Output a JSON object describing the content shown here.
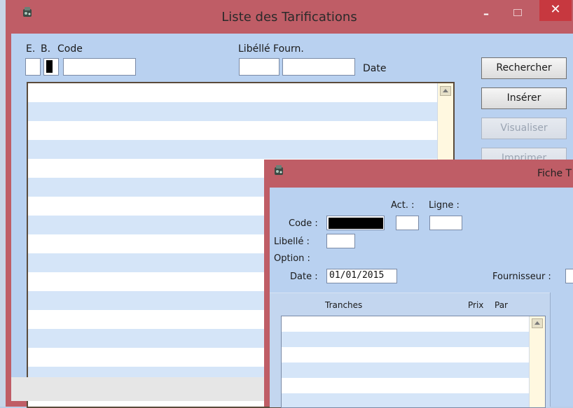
{
  "main_window": {
    "title": "Liste des Tarifications",
    "controls": {
      "minimize": "–",
      "close": "✕"
    },
    "headers": {
      "e": "E.",
      "b": "B.",
      "code": "Code",
      "libelle_fourn": "Libéllé Fourn.",
      "date": "Date"
    },
    "buttons": {
      "rechercher": "Rechercher",
      "inserer": "Insérer",
      "visualiser": "Visualiser",
      "imprimer": "Imprimer"
    }
  },
  "fiche_window": {
    "title": "Fiche T",
    "labels": {
      "act": "Act. :",
      "ligne": "Ligne :",
      "code": "Code :",
      "libelle": "Libellé :",
      "option": "Option :",
      "date": "Date :",
      "fournisseur": "Fournisseur :"
    },
    "date_value": "01/01/2015",
    "grid_headers": {
      "tranches": "Tranches",
      "prix": "Prix",
      "par": "Par"
    }
  },
  "colors": {
    "title_bar": "#bf5d66",
    "client_bg": "#b9d1f0",
    "row_alt": "#d5e5f8",
    "close_button": "#c7383f"
  }
}
